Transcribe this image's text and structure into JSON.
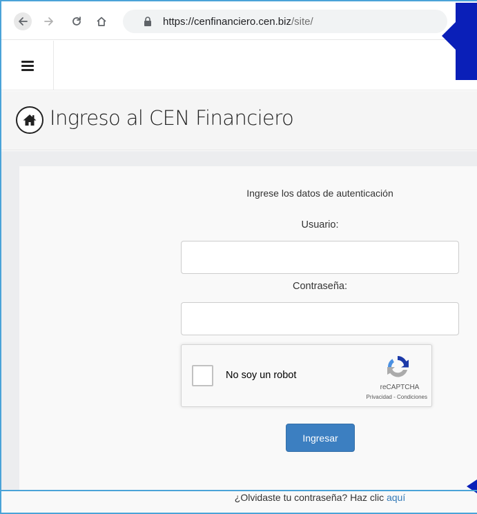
{
  "browser": {
    "url_host": "https://cenfinanciero.cen.biz",
    "url_path": "/site/"
  },
  "header": {
    "title": "Ingreso al CEN Financiero"
  },
  "login": {
    "instructions": "Ingrese los datos de autenticación",
    "user_label": "Usuario:",
    "user_value": "",
    "password_label": "Contraseña:",
    "password_value": "",
    "submit_label": "Ingresar",
    "forgot_text": "¿Olvidaste tu contraseña? Haz clic ",
    "forgot_link": "aquí"
  },
  "recaptcha": {
    "label": "No soy un robot",
    "brand": "reCAPTCHA",
    "terms": "Privacidad - Condiciones"
  },
  "colors": {
    "primary_button": "#3c7fc1",
    "link": "#337ab7",
    "annotation_pointer": "#0a1fb8",
    "frame_border": "#4aa3d8"
  },
  "icons": {
    "back": "back-arrow-icon",
    "forward": "forward-arrow-icon",
    "reload": "reload-icon",
    "home": "home-icon",
    "lock": "lock-icon",
    "menu": "hamburger-menu-icon",
    "page_home": "home-circle-icon",
    "recaptcha": "recaptcha-logo-icon"
  }
}
